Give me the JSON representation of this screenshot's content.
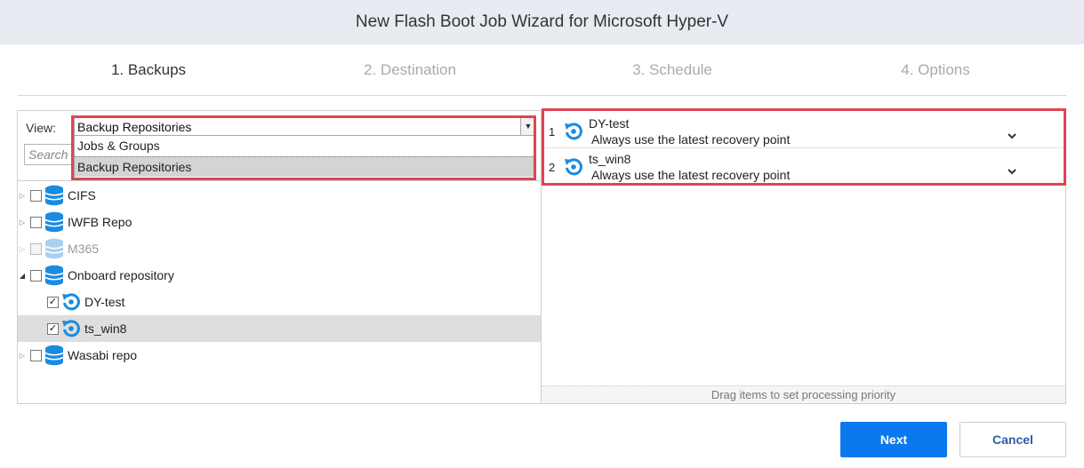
{
  "window": {
    "title": "New Flash Boot Job Wizard for Microsoft Hyper-V"
  },
  "steps": [
    {
      "label": "1. Backups",
      "active": true
    },
    {
      "label": "2. Destination",
      "active": false
    },
    {
      "label": "3. Schedule",
      "active": false
    },
    {
      "label": "4. Options",
      "active": false
    }
  ],
  "view": {
    "label": "View:",
    "selected": "Backup Repositories",
    "options": [
      "Jobs & Groups",
      "Backup Repositories"
    ]
  },
  "search": {
    "placeholder": "Search"
  },
  "tree": [
    {
      "label": "CIFS",
      "icon": "database-icon",
      "checked": false,
      "expanded": false
    },
    {
      "label": "IWFB Repo",
      "icon": "database-icon",
      "checked": false,
      "expanded": false
    },
    {
      "label": "M365",
      "icon": "database-icon",
      "checked": false,
      "expanded": false,
      "disabled": true
    },
    {
      "label": "Onboard repository",
      "icon": "database-icon",
      "checked": false,
      "expanded": true
    },
    {
      "label": "DY-test",
      "icon": "backup-sync-icon",
      "checked": true
    },
    {
      "label": "ts_win8",
      "icon": "backup-sync-icon",
      "checked": true,
      "highlighted": true
    },
    {
      "label": "Wasabi repo",
      "icon": "database-icon",
      "checked": false,
      "expanded": false
    }
  ],
  "priority_list": [
    {
      "index": "1",
      "name": "DY-test",
      "recovery_point": "Always use the latest recovery point"
    },
    {
      "index": "2",
      "name": "ts_win8",
      "recovery_point": "Always use the latest recovery point"
    }
  ],
  "drag_hint": "Drag items to set processing priority",
  "buttons": {
    "next": "Next",
    "cancel": "Cancel"
  },
  "colors": {
    "accent": "#0b79ee",
    "icon_blue": "#1b8be0",
    "highlight_border": "#e04550",
    "header_bg": "#e8ebf1"
  }
}
